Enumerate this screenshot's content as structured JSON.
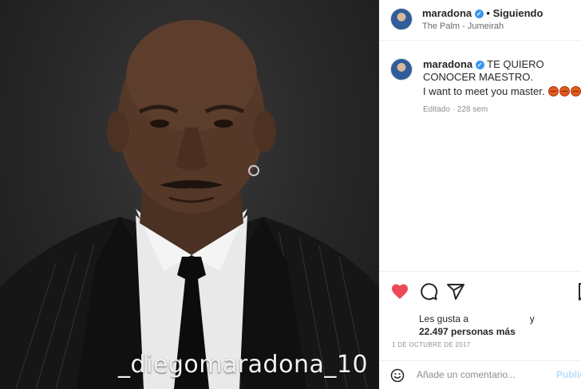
{
  "post": {
    "watermark": "_diegomaradona_10",
    "photo_description_icon": "portrait-photo"
  },
  "header": {
    "username": "maradona",
    "verified_icon": "verified-badge-icon",
    "separator": "•",
    "follow_status": "Siguiendo",
    "location": "The Palm - Jumeirah"
  },
  "caption": {
    "username": "maradona",
    "text": "TE QUIERO CONOCER MAESTRO.",
    "translation": "I want to meet you master.",
    "emoji_icon": "basketball-emoji",
    "meta": "Editado · 228 sem"
  },
  "actions": {
    "like_icon": "heart-filled-icon",
    "comment_icon": "comment-icon",
    "share_icon": "send-icon",
    "save_icon": "bookmark-icon"
  },
  "likes": {
    "prefix": "Les gusta a",
    "suffix": "y",
    "count_text": "22.497 personas más"
  },
  "date": "1 DE OCTUBRE DE 2017",
  "comment": {
    "placeholder": "Añade un comentario...",
    "publish_label": "Publicar"
  },
  "colors": {
    "like_red": "#ed4956",
    "verified_blue": "#3897f0",
    "publish_disabled": "#b2dffc"
  }
}
